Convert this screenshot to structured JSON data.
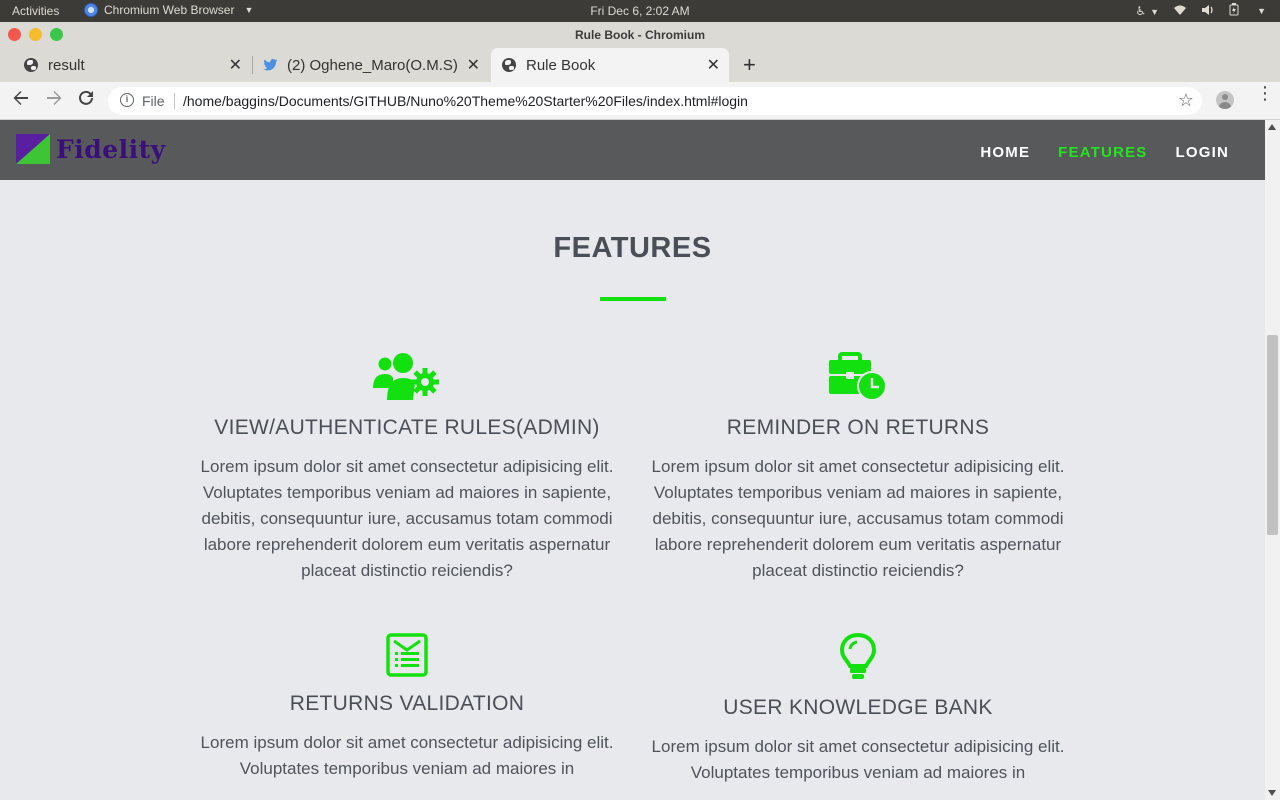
{
  "system_bar": {
    "activities": "Activities",
    "app_name": "Chromium Web Browser",
    "clock": "Fri Dec  6,  2:02 AM"
  },
  "window": {
    "title": "Rule Book - Chromium"
  },
  "tabs": [
    {
      "label": "result",
      "icon": "globe-icon"
    },
    {
      "label": "(2) Oghene_Maro(O.M.S)",
      "icon": "twitter-bird-icon"
    },
    {
      "label": "Rule Book",
      "icon": "globe-icon",
      "active": true
    }
  ],
  "address_bar": {
    "scheme_label": "File",
    "url": "/home/baggins/Documents/GITHUB/Nuno%20Theme%20Starter%20Files/index.html#login"
  },
  "site": {
    "brand": "Fidelity",
    "nav": [
      {
        "label": "HOME",
        "active": false
      },
      {
        "label": "FEATURES",
        "active": true
      },
      {
        "label": "LOGIN",
        "active": false
      }
    ],
    "section_title": "FEATURES",
    "features": [
      {
        "icon": "users-cog-icon",
        "title": "VIEW/AUTHENTICATE RULES(ADMIN)",
        "text": "Lorem ipsum dolor sit amet consectetur adipisicing elit. Voluptates temporibus veniam ad maiores in sapiente, debitis, consequuntur iure, accusamus totam commodi labore reprehenderit dolorem eum veritatis aspernatur placeat distinctio reiciendis?"
      },
      {
        "icon": "business-time-icon",
        "title": "REMINDER ON RETURNS",
        "text": "Lorem ipsum dolor sit amet consectetur adipisicing elit. Voluptates temporibus veniam ad maiores in sapiente, debitis, consequuntur iure, accusamus totam commodi labore reprehenderit dolorem eum veritatis aspernatur placeat distinctio reiciendis?"
      },
      {
        "icon": "receipt-icon",
        "title": "RETURNS VALIDATION",
        "text": "Lorem ipsum dolor sit amet consectetur adipisicing elit. Voluptates temporibus veniam ad maiores in"
      },
      {
        "icon": "lightbulb-icon",
        "title": "USER KNOWLEDGE BANK",
        "text": "Lorem ipsum dolor sit amet consectetur adipisicing elit. Voluptates temporibus veniam ad maiores in"
      }
    ]
  },
  "colors": {
    "accent_green": "#13e10f",
    "nav_bg": "#58595b",
    "page_bg": "#e8e9ec",
    "heading": "#4a4e57"
  }
}
